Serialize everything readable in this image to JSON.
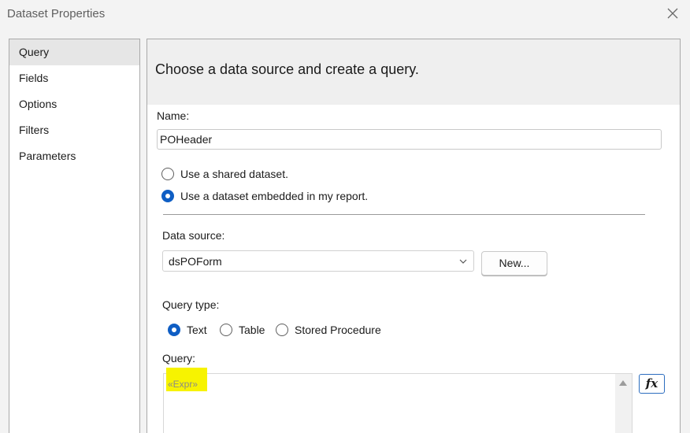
{
  "window": {
    "title": "Dataset Properties",
    "close_icon": "close-icon"
  },
  "nav": {
    "items": [
      {
        "label": "Query",
        "active": true
      },
      {
        "label": "Fields",
        "active": false
      },
      {
        "label": "Options",
        "active": false
      },
      {
        "label": "Filters",
        "active": false
      },
      {
        "label": "Parameters",
        "active": false
      }
    ]
  },
  "header": {
    "heading": "Choose a data source and create a query."
  },
  "name_field": {
    "label": "Name:",
    "value": "POHeader"
  },
  "dataset_mode": {
    "options": [
      {
        "label": "Use a shared dataset.",
        "selected": false
      },
      {
        "label": "Use a dataset embedded in my report.",
        "selected": true
      }
    ]
  },
  "data_source": {
    "label": "Data source:",
    "selected": "dsPOForm",
    "new_button": "New..."
  },
  "query_type": {
    "label": "Query type:",
    "options": [
      {
        "label": "Text",
        "selected": true
      },
      {
        "label": "Table",
        "selected": false
      },
      {
        "label": "Stored Procedure",
        "selected": false
      }
    ]
  },
  "query": {
    "label": "Query:",
    "value": "«Expr»",
    "highlight_color": "#f7f300",
    "fx_label": "fx"
  },
  "colors": {
    "accent": "#0f5ec4",
    "header_bg": "#efefef",
    "nav_active": "#e6e6e6"
  }
}
